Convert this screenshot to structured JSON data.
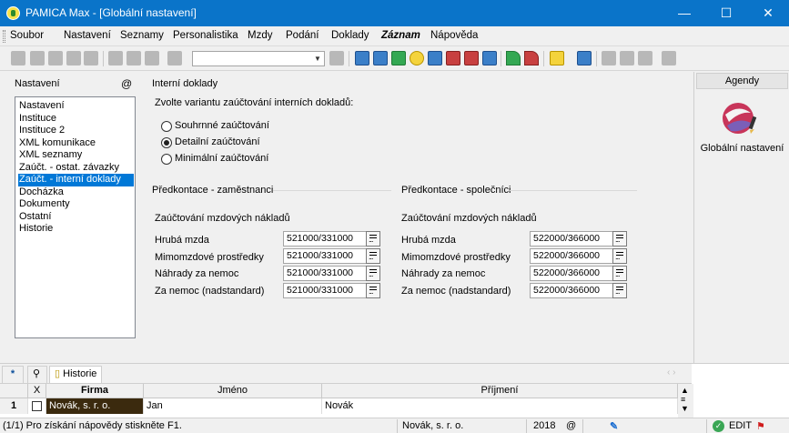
{
  "window": {
    "title": "PAMICA Max - [Globální nastavení]",
    "minimize": "—",
    "maximize": "☐",
    "close": "✕"
  },
  "menu": [
    "Soubor",
    "Nastavení",
    "Seznamy",
    "Personalistika",
    "Mzdy",
    "Podání",
    "Doklady",
    "Záznam",
    "Nápověda"
  ],
  "left": {
    "label": "Nastavení",
    "at": "@",
    "items": [
      "Nastavení",
      "Instituce",
      "Instituce 2",
      "XML komunikace",
      "XML seznamy",
      "Zaúčt. - ostat. závazky",
      "Zaúčt. - interní doklady",
      "Docházka",
      "Dokumenty",
      "Ostatní",
      "Historie"
    ],
    "selected_index": 6
  },
  "main": {
    "section_title": "Interní doklady",
    "question": "Zvolte variantu zaúčtování interních dokladů:",
    "radios": [
      "Souhrnné zaúčtování",
      "Detailní zaúčtování",
      "Minimální zaúčtování"
    ],
    "radio_selected": 1,
    "employees": {
      "title": "Předkontace - zaměstnanci",
      "subtitle": "Zaúčtování mzdových nákladů",
      "rows": [
        {
          "label": "Hrubá mzda",
          "value": "521000/331000"
        },
        {
          "label": "Mimomzdové prostředky",
          "value": "521000/331000"
        },
        {
          "label": "Náhrady za nemoc",
          "value": "521000/331000"
        },
        {
          "label": "Za nemoc (nadstandard)",
          "value": "521000/331000"
        }
      ]
    },
    "partners": {
      "title": "Předkontace - společníci",
      "subtitle": "Zaúčtování mzdových nákladů",
      "rows": [
        {
          "label": "Hrubá mzda",
          "value": "522000/366000"
        },
        {
          "label": "Mimomzdové prostředky",
          "value": "522000/366000"
        },
        {
          "label": "Náhrady za nemoc",
          "value": "522000/366000"
        },
        {
          "label": "Za nemoc (nadstandard)",
          "value": "522000/366000"
        }
      ]
    }
  },
  "agendy": {
    "header": "Agendy",
    "item": "Globální nastavení"
  },
  "bottom": {
    "tab_star": "*",
    "tab_history": "Historie",
    "columns": [
      "X",
      "Firma",
      "Jméno",
      "Příjmení"
    ],
    "row": {
      "num": "1",
      "firma": "Novák, s. r. o.",
      "jmeno": "Jan",
      "prijmeni": "Novák"
    }
  },
  "status": {
    "help": "(1/1) Pro získání nápovědy stiskněte F1.",
    "company": "Novák, s. r. o.",
    "year": "2018",
    "at": "@",
    "mode": "EDIT"
  }
}
